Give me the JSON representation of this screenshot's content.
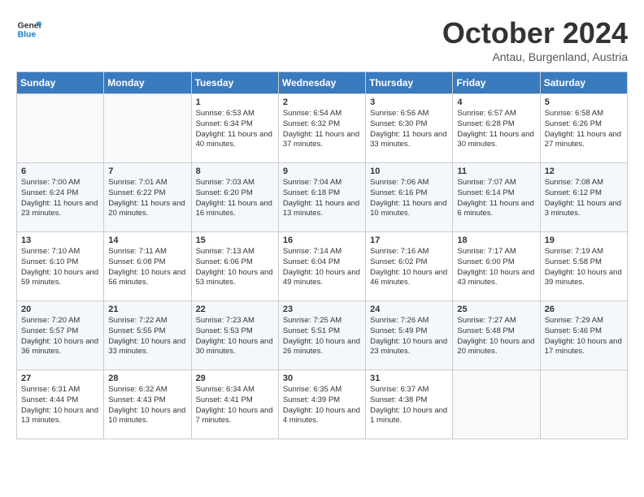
{
  "header": {
    "logo_general": "General",
    "logo_blue": "Blue",
    "month_title": "October 2024",
    "subtitle": "Antau, Burgenland, Austria"
  },
  "days_of_week": [
    "Sunday",
    "Monday",
    "Tuesday",
    "Wednesday",
    "Thursday",
    "Friday",
    "Saturday"
  ],
  "weeks": [
    [
      {
        "day": "",
        "info": ""
      },
      {
        "day": "",
        "info": ""
      },
      {
        "day": "1",
        "info": "Sunrise: 6:53 AM\nSunset: 6:34 PM\nDaylight: 11 hours and 40 minutes."
      },
      {
        "day": "2",
        "info": "Sunrise: 6:54 AM\nSunset: 6:32 PM\nDaylight: 11 hours and 37 minutes."
      },
      {
        "day": "3",
        "info": "Sunrise: 6:56 AM\nSunset: 6:30 PM\nDaylight: 11 hours and 33 minutes."
      },
      {
        "day": "4",
        "info": "Sunrise: 6:57 AM\nSunset: 6:28 PM\nDaylight: 11 hours and 30 minutes."
      },
      {
        "day": "5",
        "info": "Sunrise: 6:58 AM\nSunset: 6:26 PM\nDaylight: 11 hours and 27 minutes."
      }
    ],
    [
      {
        "day": "6",
        "info": "Sunrise: 7:00 AM\nSunset: 6:24 PM\nDaylight: 11 hours and 23 minutes."
      },
      {
        "day": "7",
        "info": "Sunrise: 7:01 AM\nSunset: 6:22 PM\nDaylight: 11 hours and 20 minutes."
      },
      {
        "day": "8",
        "info": "Sunrise: 7:03 AM\nSunset: 6:20 PM\nDaylight: 11 hours and 16 minutes."
      },
      {
        "day": "9",
        "info": "Sunrise: 7:04 AM\nSunset: 6:18 PM\nDaylight: 11 hours and 13 minutes."
      },
      {
        "day": "10",
        "info": "Sunrise: 7:06 AM\nSunset: 6:16 PM\nDaylight: 11 hours and 10 minutes."
      },
      {
        "day": "11",
        "info": "Sunrise: 7:07 AM\nSunset: 6:14 PM\nDaylight: 11 hours and 6 minutes."
      },
      {
        "day": "12",
        "info": "Sunrise: 7:08 AM\nSunset: 6:12 PM\nDaylight: 11 hours and 3 minutes."
      }
    ],
    [
      {
        "day": "13",
        "info": "Sunrise: 7:10 AM\nSunset: 6:10 PM\nDaylight: 10 hours and 59 minutes."
      },
      {
        "day": "14",
        "info": "Sunrise: 7:11 AM\nSunset: 6:08 PM\nDaylight: 10 hours and 56 minutes."
      },
      {
        "day": "15",
        "info": "Sunrise: 7:13 AM\nSunset: 6:06 PM\nDaylight: 10 hours and 53 minutes."
      },
      {
        "day": "16",
        "info": "Sunrise: 7:14 AM\nSunset: 6:04 PM\nDaylight: 10 hours and 49 minutes."
      },
      {
        "day": "17",
        "info": "Sunrise: 7:16 AM\nSunset: 6:02 PM\nDaylight: 10 hours and 46 minutes."
      },
      {
        "day": "18",
        "info": "Sunrise: 7:17 AM\nSunset: 6:00 PM\nDaylight: 10 hours and 43 minutes."
      },
      {
        "day": "19",
        "info": "Sunrise: 7:19 AM\nSunset: 5:58 PM\nDaylight: 10 hours and 39 minutes."
      }
    ],
    [
      {
        "day": "20",
        "info": "Sunrise: 7:20 AM\nSunset: 5:57 PM\nDaylight: 10 hours and 36 minutes."
      },
      {
        "day": "21",
        "info": "Sunrise: 7:22 AM\nSunset: 5:55 PM\nDaylight: 10 hours and 33 minutes."
      },
      {
        "day": "22",
        "info": "Sunrise: 7:23 AM\nSunset: 5:53 PM\nDaylight: 10 hours and 30 minutes."
      },
      {
        "day": "23",
        "info": "Sunrise: 7:25 AM\nSunset: 5:51 PM\nDaylight: 10 hours and 26 minutes."
      },
      {
        "day": "24",
        "info": "Sunrise: 7:26 AM\nSunset: 5:49 PM\nDaylight: 10 hours and 23 minutes."
      },
      {
        "day": "25",
        "info": "Sunrise: 7:27 AM\nSunset: 5:48 PM\nDaylight: 10 hours and 20 minutes."
      },
      {
        "day": "26",
        "info": "Sunrise: 7:29 AM\nSunset: 5:46 PM\nDaylight: 10 hours and 17 minutes."
      }
    ],
    [
      {
        "day": "27",
        "info": "Sunrise: 6:31 AM\nSunset: 4:44 PM\nDaylight: 10 hours and 13 minutes."
      },
      {
        "day": "28",
        "info": "Sunrise: 6:32 AM\nSunset: 4:43 PM\nDaylight: 10 hours and 10 minutes."
      },
      {
        "day": "29",
        "info": "Sunrise: 6:34 AM\nSunset: 4:41 PM\nDaylight: 10 hours and 7 minutes."
      },
      {
        "day": "30",
        "info": "Sunrise: 6:35 AM\nSunset: 4:39 PM\nDaylight: 10 hours and 4 minutes."
      },
      {
        "day": "31",
        "info": "Sunrise: 6:37 AM\nSunset: 4:38 PM\nDaylight: 10 hours and 1 minute."
      },
      {
        "day": "",
        "info": ""
      },
      {
        "day": "",
        "info": ""
      }
    ]
  ]
}
